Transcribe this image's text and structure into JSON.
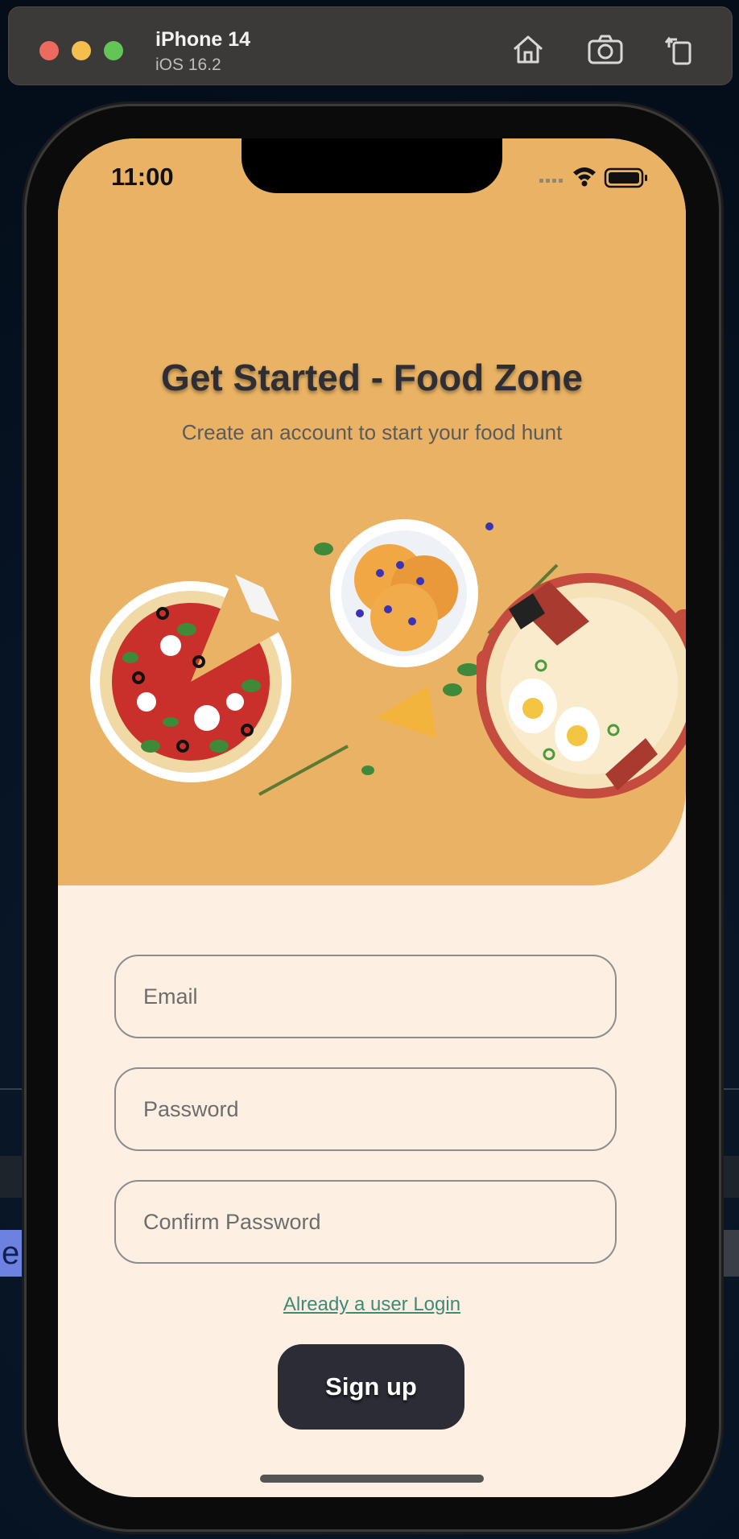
{
  "simulator": {
    "device_name": "iPhone 14",
    "os_version": "iOS 16.2",
    "toolbar_icons": [
      "home-icon",
      "screenshot-icon",
      "rotate-icon"
    ]
  },
  "status_bar": {
    "time": "11:00",
    "icons": [
      "signal-icon",
      "wifi-icon",
      "battery-icon"
    ]
  },
  "header": {
    "title": "Get Started - Food Zone",
    "subtitle": "Create an account to start your food hunt"
  },
  "form": {
    "email_placeholder": "Email",
    "password_placeholder": "Password",
    "confirm_placeholder": "Confirm Password",
    "login_link": "Already a user Login",
    "signup_label": "Sign up"
  },
  "colors": {
    "header_bg": "#e9b264",
    "page_bg": "#fdf0e3",
    "button_bg": "#2b2c35",
    "link": "#3f8a76"
  },
  "background": {
    "partial_tab_letter": "e"
  }
}
